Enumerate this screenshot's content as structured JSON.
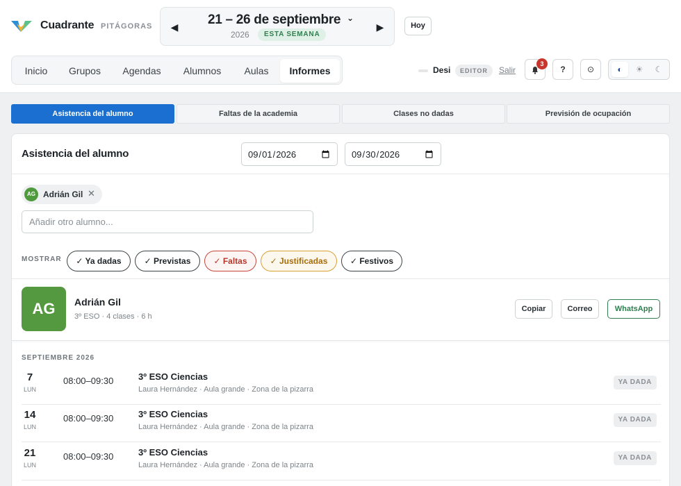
{
  "brand": {
    "name": "Cuadrante",
    "subtitle": "PITÁGORAS"
  },
  "week": {
    "range": "21 – 26 de septiembre",
    "year": "2026",
    "badge": "ESTA SEMANA"
  },
  "today_button": "Hoy",
  "nav": {
    "items": [
      {
        "label": "Inicio"
      },
      {
        "label": "Grupos"
      },
      {
        "label": "Agendas"
      },
      {
        "label": "Alumnos"
      },
      {
        "label": "Aulas"
      },
      {
        "label": "Informes",
        "active": true
      }
    ]
  },
  "user": {
    "name": "Desi",
    "role": "EDITOR",
    "logout": "Salir"
  },
  "notifications": {
    "count": "3"
  },
  "help_label": "?",
  "report_tabs": [
    {
      "label": "Asistencia del alumno",
      "active": true
    },
    {
      "label": "Faltas de la academia"
    },
    {
      "label": "Clases no dadas"
    },
    {
      "label": "Previsión de ocupación"
    }
  ],
  "panel": {
    "title": "Asistencia del alumno",
    "date_from": "2026-09-01",
    "date_to": "2026-09-30",
    "selected_student": {
      "initials": "AG",
      "name": "Adrián Gil"
    },
    "add_placeholder": "Añadir otro alumno...",
    "show_label": "MOSTRAR",
    "filters": [
      {
        "label": "✓ Ya dadas"
      },
      {
        "label": "✓ Previstas"
      },
      {
        "label": "✓ Faltas"
      },
      {
        "label": "✓ Justificadas"
      },
      {
        "label": "✓ Festivos"
      }
    ]
  },
  "student": {
    "initials": "AG",
    "name": "Adrián Gil",
    "meta": "3º ESO · 4 clases · 6 h",
    "actions": {
      "copy": "Copiar",
      "email": "Correo",
      "whatsapp": "WhatsApp"
    }
  },
  "sessions": {
    "month": "SEPTIEMBRE 2026",
    "rows": [
      {
        "day": "7",
        "dow": "LUN",
        "time": "08:00–09:30",
        "class": "3º ESO Ciencias",
        "detail": "Laura Hernández · Aula grande · Zona de la pizarra",
        "status": "YA DADA"
      },
      {
        "day": "14",
        "dow": "LUN",
        "time": "08:00–09:30",
        "class": "3º ESO Ciencias",
        "detail": "Laura Hernández · Aula grande · Zona de la pizarra",
        "status": "YA DADA"
      },
      {
        "day": "21",
        "dow": "LUN",
        "time": "08:00–09:30",
        "class": "3º ESO Ciencias",
        "detail": "Laura Hernández · Aula grande · Zona de la pizarra",
        "status": "YA DADA"
      }
    ]
  },
  "colors": {
    "primary": "#1b6fd0",
    "success": "#2f7e4f",
    "avatar": "#54993f",
    "danger": "#c9453b",
    "warning": "#d9a02f"
  }
}
